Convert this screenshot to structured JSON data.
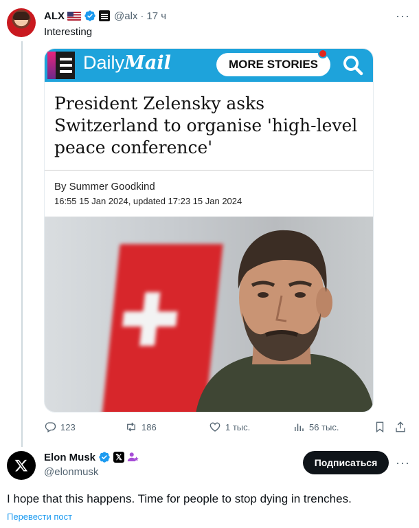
{
  "tweet1": {
    "author_name": "ALX",
    "handle": "@alx",
    "separator": "·",
    "time": "17 ч",
    "text": "Interesting",
    "icons": [
      "avatar",
      "us-flag-icon",
      "verified-badge-icon",
      "affiliation-badge-icon",
      "more-icon"
    ],
    "stats": {
      "replies": "123",
      "reposts": "186",
      "likes": "1 тыс.",
      "views": "56 тыс."
    }
  },
  "media": {
    "brand_daily": "Daily",
    "brand_mail": "Mail",
    "more_stories": "MORE STORIES",
    "headline": "President Zelensky asks Switzerland to organise 'high-level peace conference'",
    "byline": "By Summer Goodkind",
    "date": "16:55 15 Jan 2024, updated 17:23 15 Jan 2024",
    "colors": {
      "header_blue": "#1ea3db",
      "flag_red": "#d7262b"
    }
  },
  "tweet2": {
    "author_name": "Elon Musk",
    "handle": "@elonmusk",
    "follow_label": "Подписаться",
    "text": "I hope that this happens. Time for people to stop dying in trenches.",
    "translate_label": "Перевести пост"
  },
  "colors": {
    "link_blue": "#1d9bf0",
    "muted": "#536471",
    "verified_blue": "#1d9bf0"
  }
}
